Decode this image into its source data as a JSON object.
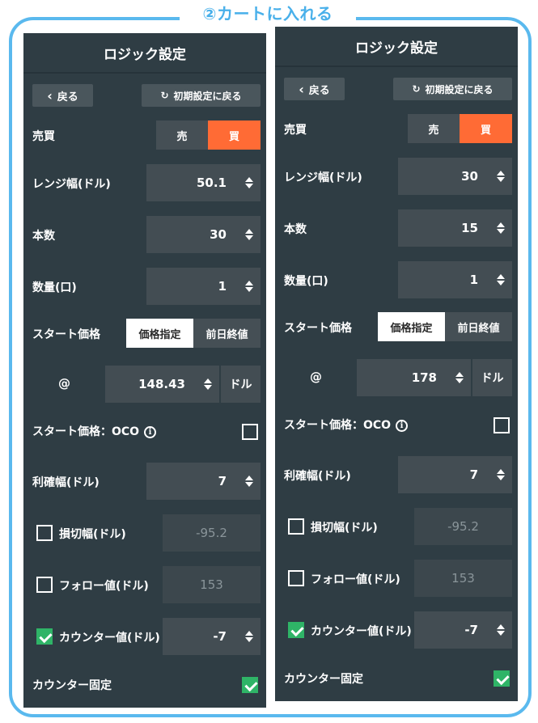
{
  "banner": {
    "title": "②カートに入れる"
  },
  "panels": [
    {
      "title": "ロジック設定",
      "back_label": "戻る",
      "reset_label": "初期設定に戻る",
      "trade_label": "売買",
      "sell_label": "売",
      "buy_label": "買",
      "selected_side": "buy",
      "range_label": "レンジ幅(ドル)",
      "range_value": "50.1",
      "count_label": "本数",
      "count_value": "30",
      "qty_label": "数量(口)",
      "qty_value": "1",
      "start_label": "スタート価格",
      "price_spec_label": "価格指定",
      "prev_close_label": "前日終値",
      "at_symbol": "@",
      "start_price": "148.43",
      "unit_label": "ドル",
      "oco_label": "スタート価格：OCO",
      "oco_checked": false,
      "take_profit_label": "利確幅(ドル)",
      "take_profit_value": "7",
      "stop_loss_label": "損切幅(ドル)",
      "stop_loss_value": "-95.2",
      "stop_loss_checked": false,
      "follow_label": "フォロー値(ドル)",
      "follow_value": "153",
      "follow_checked": false,
      "counter_label": "カウンター値(ドル)",
      "counter_value": "-7",
      "counter_checked": true,
      "counter_fixed_label": "カウンター固定",
      "counter_fixed_checked": true
    },
    {
      "title": "ロジック設定",
      "back_label": "戻る",
      "reset_label": "初期設定に戻る",
      "trade_label": "売買",
      "sell_label": "売",
      "buy_label": "買",
      "selected_side": "buy",
      "range_label": "レンジ幅(ドル)",
      "range_value": "30",
      "count_label": "本数",
      "count_value": "15",
      "qty_label": "数量(口)",
      "qty_value": "1",
      "start_label": "スタート価格",
      "price_spec_label": "価格指定",
      "prev_close_label": "前日終値",
      "at_symbol": "@",
      "start_price": "178",
      "unit_label": "ドル",
      "oco_label": "スタート価格：OCO",
      "oco_checked": false,
      "take_profit_label": "利確幅(ドル)",
      "take_profit_value": "7",
      "stop_loss_label": "損切幅(ドル)",
      "stop_loss_value": "-95.2",
      "stop_loss_checked": false,
      "follow_label": "フォロー値(ドル)",
      "follow_value": "153",
      "follow_checked": false,
      "counter_label": "カウンター値(ドル)",
      "counter_value": "-7",
      "counter_checked": true,
      "counter_fixed_label": "カウンター固定",
      "counter_fixed_checked": true
    }
  ],
  "colors": {
    "frame": "#5ab9ee",
    "panel_bg": "#2f3d44",
    "active_orange": "#ff6b35",
    "check_green": "#2fb467"
  }
}
